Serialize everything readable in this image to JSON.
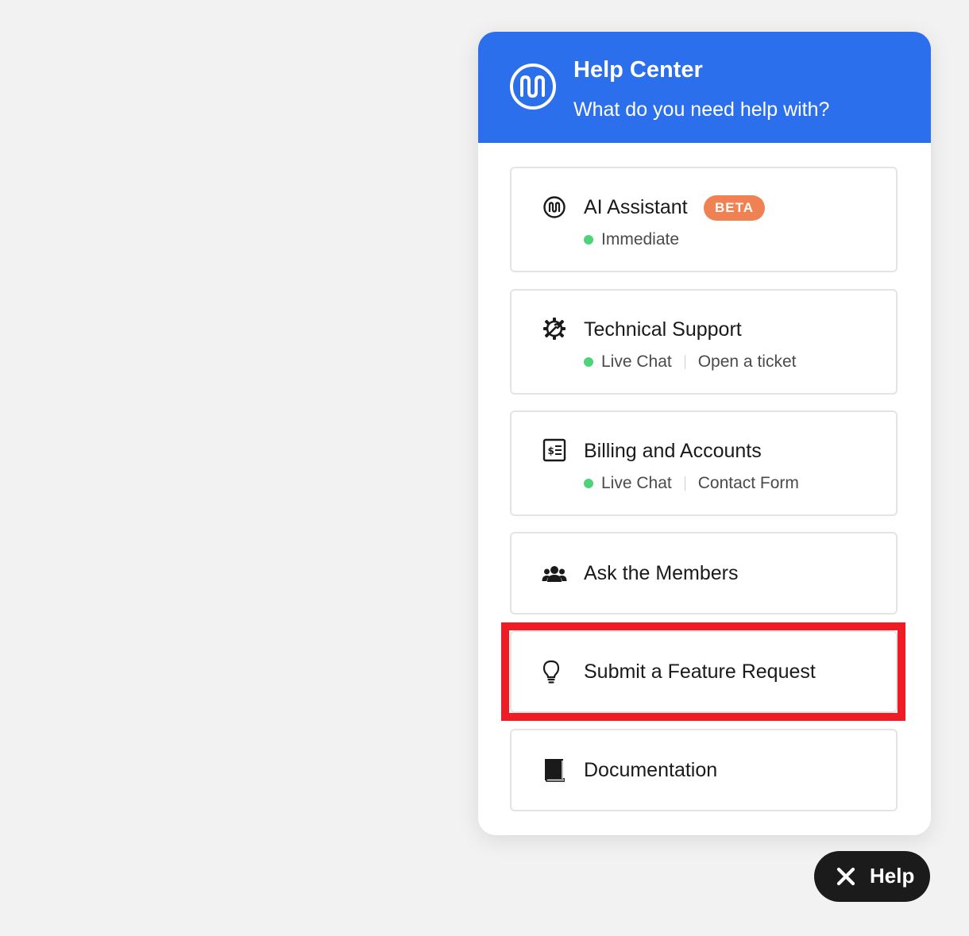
{
  "header": {
    "title": "Help Center",
    "subtitle": "What do you need help with?",
    "logo_icon": "brand-wave-logo",
    "background_color": "#2b6fec"
  },
  "options": {
    "ai_assistant": {
      "title": "AI Assistant",
      "badge": "BETA",
      "status": "Immediate",
      "icon": "ai-assistant-icon"
    },
    "technical_support": {
      "title": "Technical Support",
      "status": "Live Chat",
      "alt_action": "Open a ticket",
      "icon": "gear-wrench-icon"
    },
    "billing": {
      "title": "Billing and Accounts",
      "status": "Live Chat",
      "alt_action": "Contact Form",
      "icon": "invoice-icon"
    },
    "community": {
      "title": "Ask the Members",
      "icon": "group-icon"
    },
    "feature_request": {
      "title": "Submit a Feature Request",
      "icon": "lightbulb-icon"
    },
    "documentation": {
      "title": "Documentation",
      "icon": "book-icon"
    }
  },
  "toggle": {
    "label": "Help",
    "icon": "close-icon"
  },
  "colors": {
    "accent": "#2b6fec",
    "badge": "#ef8153",
    "status_online": "#4fd378",
    "highlight": "#ee1d25"
  }
}
